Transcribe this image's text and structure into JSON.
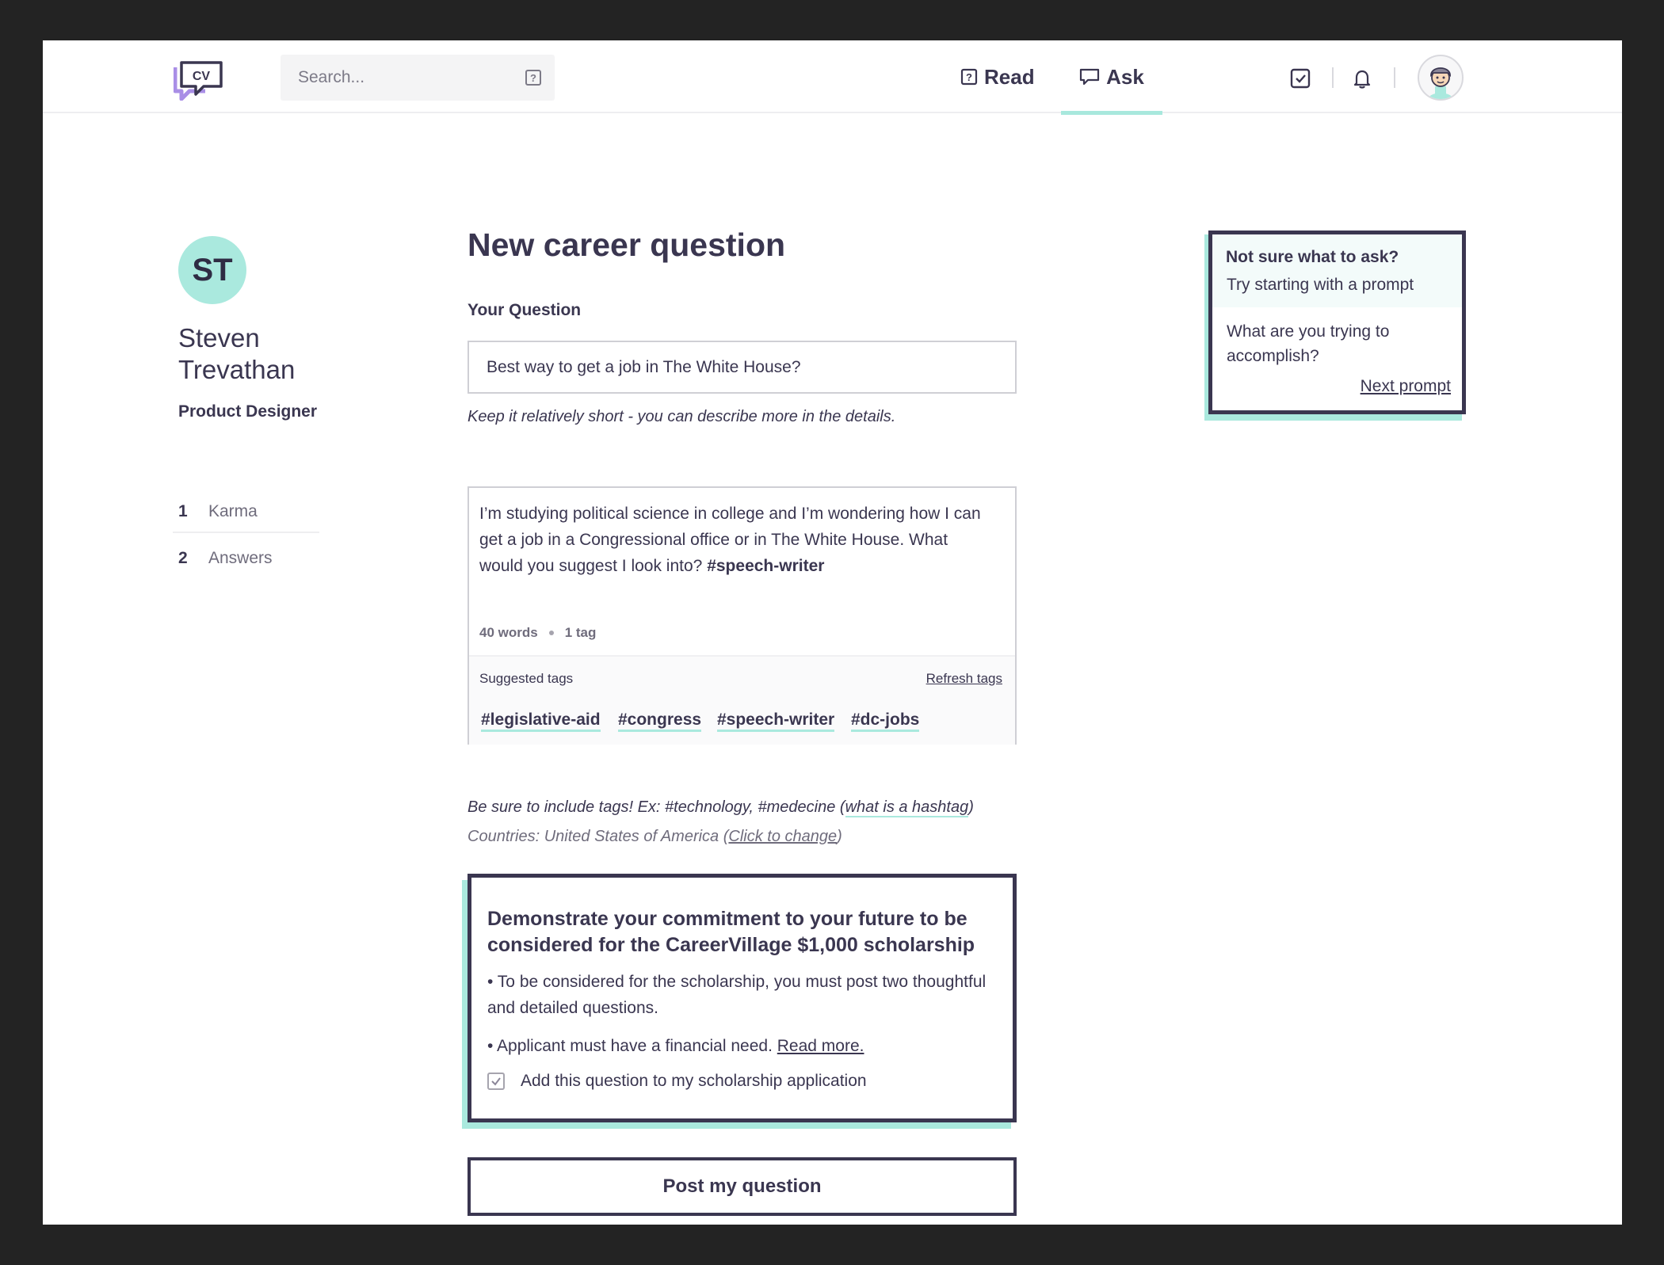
{
  "header": {
    "logo_text": "CV",
    "search_placeholder": "Search...",
    "nav": [
      {
        "label": "Read",
        "icon": "question-box-icon",
        "active": false
      },
      {
        "label": "Ask",
        "icon": "speech-bubble-icon",
        "active": true
      }
    ],
    "icons": [
      "check-box-icon",
      "bell-icon",
      "avatar-icon"
    ]
  },
  "profile": {
    "initials": "ST",
    "name": "Steven Trevathan",
    "role": "Product Designer",
    "stats": [
      {
        "value": "1",
        "label": "Karma"
      },
      {
        "value": "2",
        "label": "Answers"
      }
    ]
  },
  "form": {
    "title": "New career question",
    "question_label": "Your Question",
    "question_value": "Best way to get a job in The White House?",
    "question_hint": "Keep it relatively short - you can describe more in the details.",
    "details_text": "I’m studying political science in college and I’m wondering how I can get a job in a Congressional office or in The White House. What would you suggest I look into?",
    "details_tag": "#speech-writer",
    "word_count": "40 words",
    "tag_count": "1 tag",
    "suggested_label": "Suggested tags",
    "refresh_label": "Refresh tags",
    "suggested_tags": [
      "#legislative-aid",
      "#congress",
      "#speech-writer",
      "#dc-jobs"
    ],
    "tags_hint_prefix": "Be sure to include tags! Ex: #technology, #medecine (",
    "tags_hint_link": "what is a hashtag",
    "tags_hint_suffix": ")",
    "countries_prefix": "Countries: United States of America (",
    "countries_link": "Click to change",
    "countries_suffix": ")"
  },
  "scholarship": {
    "title": "Demonstrate your commitment to your future to be considered for the CareerVillage $1,000 scholarship",
    "bullet_1": "• To be considered for the scholarship, you must post two thoughtful and detailed questions.",
    "bullet_2_prefix": "• Applicant must have a financial need.",
    "bullet_2_link": "Read more.",
    "checkbox_label": "Add this question to my scholarship application",
    "checked": true
  },
  "post_button": "Post my question",
  "prompt": {
    "title": "Not sure what to ask?",
    "subtitle": "Try starting with a prompt",
    "question": "What are you trying to accomplish?",
    "next_label": "Next prompt"
  },
  "colors": {
    "accent": "#aae9de",
    "text": "#3a3650",
    "logo_purple": "#a98ee6"
  }
}
